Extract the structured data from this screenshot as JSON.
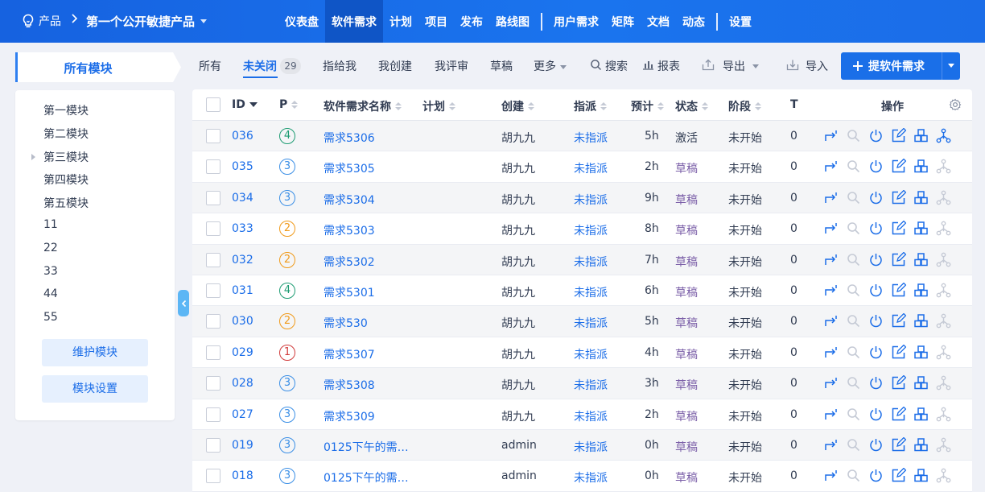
{
  "colors": {
    "brand": "#1b6de8",
    "topbar": "#1a6ee9",
    "purple_status": "#7b5fa8"
  },
  "topbar": {
    "product_label": "产品",
    "product_name": "第一个公开敏捷产品",
    "nav": [
      {
        "label": "仪表盘",
        "active": false,
        "sep_after": false
      },
      {
        "label": "软件需求",
        "active": true,
        "sep_after": false
      },
      {
        "label": "计划",
        "active": false,
        "sep_after": false
      },
      {
        "label": "项目",
        "active": false,
        "sep_after": false
      },
      {
        "label": "发布",
        "active": false,
        "sep_after": false
      },
      {
        "label": "路线图",
        "active": false,
        "sep_after": true
      },
      {
        "label": "用户需求",
        "active": false,
        "sep_after": false
      },
      {
        "label": "矩阵",
        "active": false,
        "sep_after": false
      },
      {
        "label": "文档",
        "active": false,
        "sep_after": false
      },
      {
        "label": "动态",
        "active": false,
        "sep_after": true
      },
      {
        "label": "设置",
        "active": false,
        "sep_after": false
      }
    ]
  },
  "sidebar": {
    "title": "所有模块",
    "modules": [
      "第一模块",
      "第二模块",
      "第三模块",
      "第四模块",
      "第五模块",
      "11",
      "22",
      "33",
      "44",
      "55"
    ],
    "expandable_index": 2,
    "maintain_label": "维护模块",
    "settings_label": "模块设置"
  },
  "toolbar": {
    "tabs": [
      "所有",
      "未关闭",
      "指给我",
      "我创建",
      "我评审",
      "草稿",
      "更多"
    ],
    "active_tab": "未关闭",
    "unclosed_count": "29",
    "search": "搜索",
    "report": "报表",
    "export": "导出",
    "import": "导入",
    "create": "提软件需求"
  },
  "table": {
    "columns": {
      "id": "ID",
      "pri": "P",
      "title": "软件需求名称",
      "plan": "计划",
      "creator": "创建",
      "assign": "指派",
      "estimate": "预计",
      "status": "状态",
      "stage": "阶段",
      "t": "T",
      "actions": "操作"
    },
    "rows": [
      {
        "id": "036",
        "pri": "4",
        "title": "需求5306",
        "creator": "胡九九",
        "assign": "未指派",
        "estimate": "5h",
        "status": "激活",
        "stage": "未开始",
        "t": "0",
        "plan": ""
      },
      {
        "id": "035",
        "pri": "3",
        "title": "需求5305",
        "creator": "胡九九",
        "assign": "未指派",
        "estimate": "2h",
        "status": "草稿",
        "stage": "未开始",
        "t": "0",
        "plan": ""
      },
      {
        "id": "034",
        "pri": "3",
        "title": "需求5304",
        "creator": "胡九九",
        "assign": "未指派",
        "estimate": "9h",
        "status": "草稿",
        "stage": "未开始",
        "t": "0",
        "plan": ""
      },
      {
        "id": "033",
        "pri": "2",
        "title": "需求5303",
        "creator": "胡九九",
        "assign": "未指派",
        "estimate": "8h",
        "status": "草稿",
        "stage": "未开始",
        "t": "0",
        "plan": ""
      },
      {
        "id": "032",
        "pri": "2",
        "title": "需求5302",
        "creator": "胡九九",
        "assign": "未指派",
        "estimate": "7h",
        "status": "草稿",
        "stage": "未开始",
        "t": "0",
        "plan": ""
      },
      {
        "id": "031",
        "pri": "4",
        "title": "需求5301",
        "creator": "胡九九",
        "assign": "未指派",
        "estimate": "6h",
        "status": "草稿",
        "stage": "未开始",
        "t": "0",
        "plan": ""
      },
      {
        "id": "030",
        "pri": "2",
        "title": "需求530",
        "creator": "胡九九",
        "assign": "未指派",
        "estimate": "5h",
        "status": "草稿",
        "stage": "未开始",
        "t": "0",
        "plan": ""
      },
      {
        "id": "029",
        "pri": "1",
        "title": "需求5307",
        "creator": "胡九九",
        "assign": "未指派",
        "estimate": "4h",
        "status": "草稿",
        "stage": "未开始",
        "t": "0",
        "plan": ""
      },
      {
        "id": "028",
        "pri": "3",
        "title": "需求5308",
        "creator": "胡九九",
        "assign": "未指派",
        "estimate": "3h",
        "status": "草稿",
        "stage": "未开始",
        "t": "0",
        "plan": ""
      },
      {
        "id": "027",
        "pri": "3",
        "title": "需求5309",
        "creator": "胡九九",
        "assign": "未指派",
        "estimate": "2h",
        "status": "草稿",
        "stage": "未开始",
        "t": "0",
        "plan": ""
      },
      {
        "id": "019",
        "pri": "3",
        "title": "0125下午的需…",
        "creator": "admin",
        "assign": "未指派",
        "estimate": "0h",
        "status": "草稿",
        "stage": "未开始",
        "t": "0",
        "plan": ""
      },
      {
        "id": "018",
        "pri": "3",
        "title": "0125下午的需…",
        "creator": "admin",
        "assign": "未指派",
        "estimate": "0h",
        "status": "草稿",
        "stage": "未开始",
        "t": "0",
        "plan": ""
      }
    ]
  }
}
